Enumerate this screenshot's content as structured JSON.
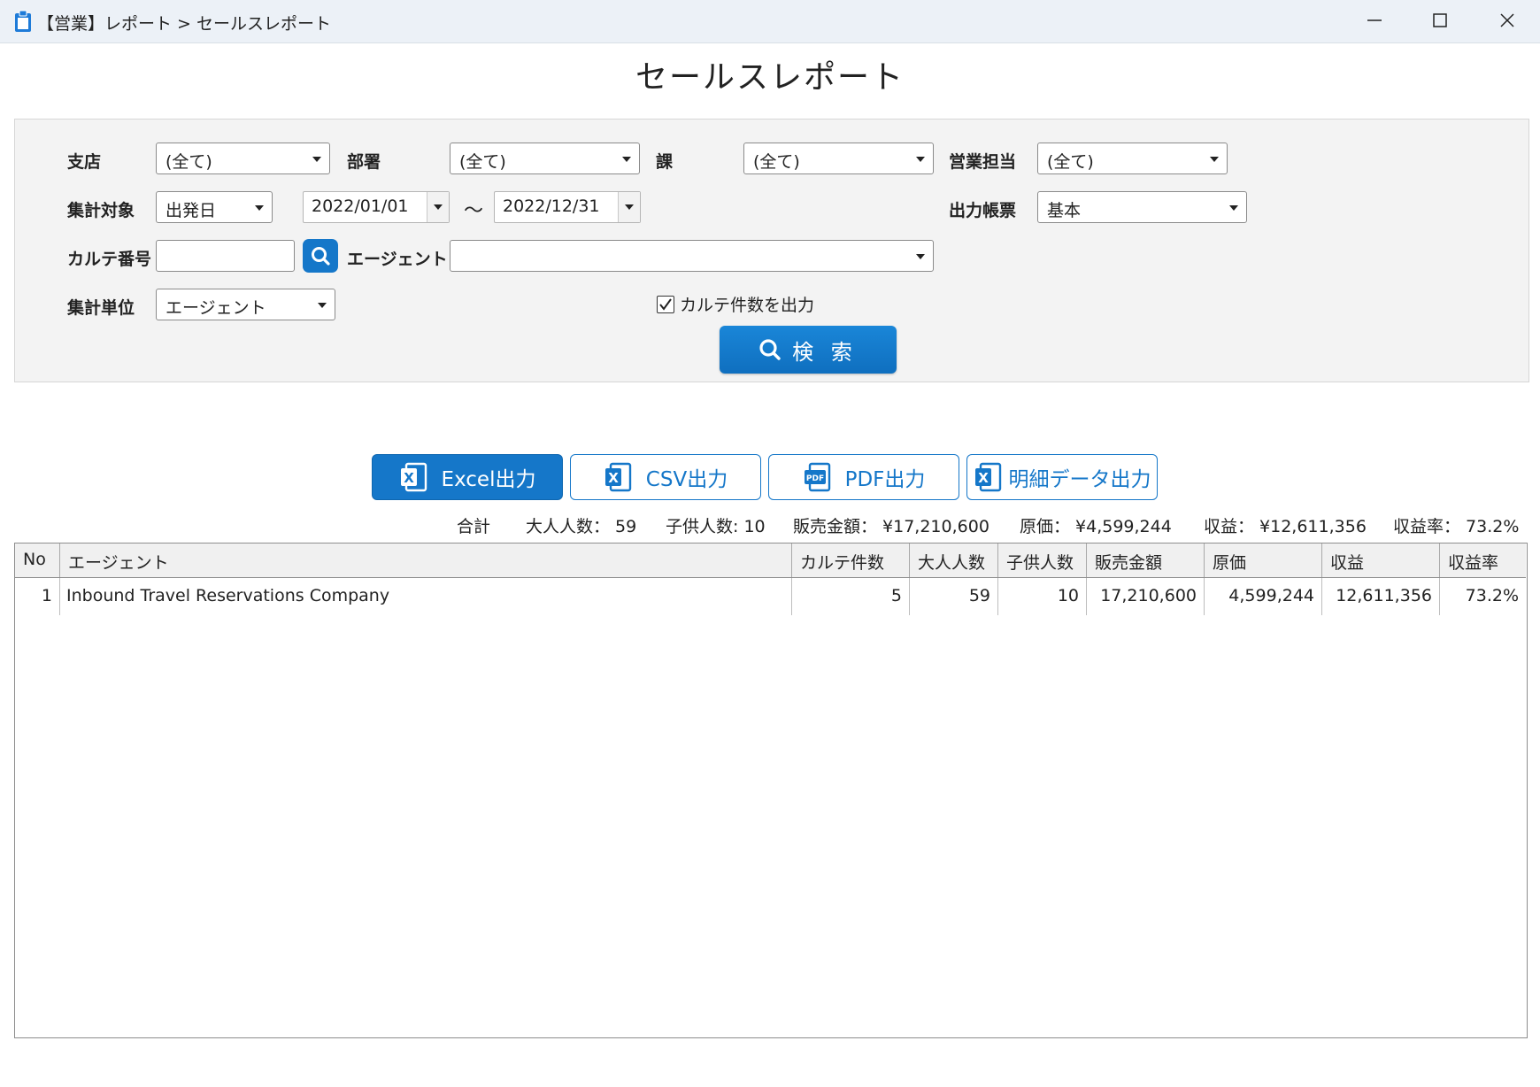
{
  "window": {
    "title": "【営業】レポート > セールスレポート"
  },
  "page_title": "セールスレポート",
  "filters": {
    "branch_label": "支店",
    "branch_value": "(全て)",
    "department_label": "部署",
    "department_value": "(全て)",
    "section_label": "課",
    "section_value": "(全て)",
    "sales_rep_label": "営業担当",
    "sales_rep_value": "(全て)",
    "target_label": "集計対象",
    "target_value": "出発日",
    "date_from": "2022/01/01",
    "tilde": "～",
    "date_to": "2022/12/31",
    "report_label": "出力帳票",
    "report_value": "基本",
    "karte_label": "カルテ番号",
    "karte_value": "",
    "agent_label": "エージェント",
    "agent_value": "",
    "unit_label": "集計単位",
    "unit_value": "エージェント",
    "checkbox_label": "カルテ件数を出力",
    "checkbox_checked": true,
    "search_label": "検 索"
  },
  "export_buttons": {
    "excel": "Excel出力",
    "csv": "CSV出力",
    "pdf": "PDF出力",
    "detail": "明細データ出力"
  },
  "totals": {
    "label": "合計",
    "adults": "大人人数： 59",
    "children": "子供人数: 10",
    "sales": "販売金額： ¥17,210,600",
    "cost": "原価： ¥4,599,244",
    "profit": "収益： ¥12,611,356",
    "margin": "収益率： 73.2%"
  },
  "table": {
    "headers": [
      "No",
      "エージェント",
      "カルテ件数",
      "大人人数",
      "子供人数",
      "販売金額",
      "原価",
      "収益",
      "収益率"
    ],
    "rows": [
      [
        "1",
        "Inbound Travel Reservations Company",
        "5",
        "59",
        "10",
        "17,210,600",
        "4,599,244",
        "12,611,356",
        "73.2%"
      ]
    ]
  },
  "colors": {
    "accent": "#1577c9",
    "titlebar": "#ecf1f7",
    "panel": "#f3f3f3"
  }
}
